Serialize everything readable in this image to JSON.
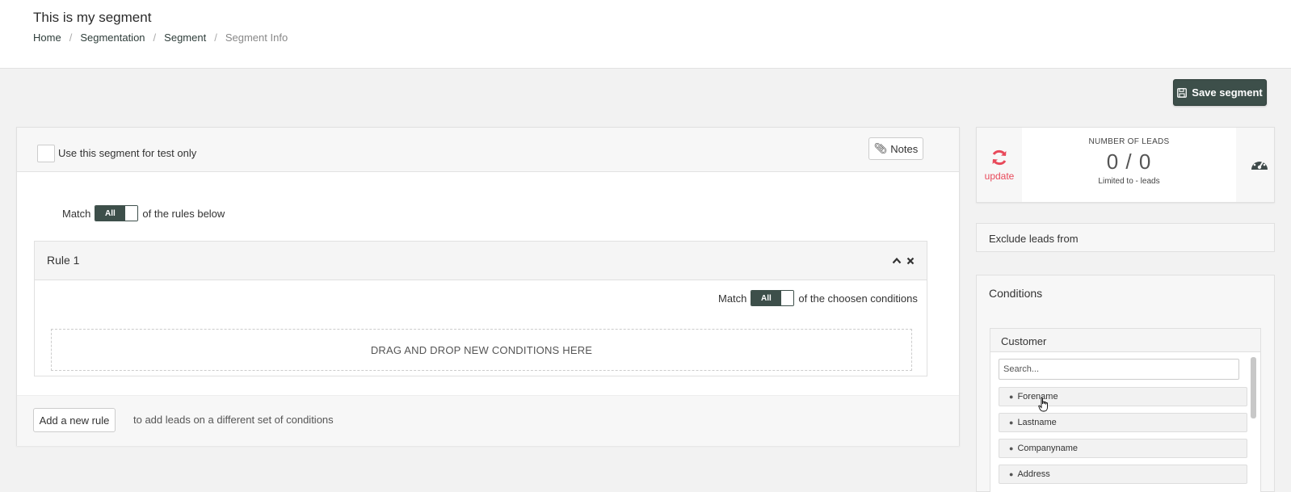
{
  "header": {
    "title": "This is my segment",
    "breadcrumb": [
      {
        "label": "Home"
      },
      {
        "label": "Segmentation"
      },
      {
        "label": "Segment"
      },
      {
        "label": "Segment Info"
      }
    ],
    "separator": "/"
  },
  "toolbar": {
    "save_label": "Save segment"
  },
  "segment": {
    "test_only_label": "Use this segment for test only",
    "test_only_checked": false,
    "notes_label": "Notes",
    "match_prefix": "Match",
    "match_value": "All",
    "match_suffix": "of the rules below"
  },
  "rule": {
    "title": "Rule 1",
    "match_prefix": "Match",
    "match_value": "All",
    "match_suffix": "of the choosen conditions",
    "drop_text": "DRAG AND DROP NEW CONDITIONS HERE"
  },
  "footer": {
    "add_rule_label": "Add a new rule",
    "add_rule_hint": "to add leads on a different set of conditions"
  },
  "leads": {
    "update_label": "update",
    "title": "NUMBER OF LEADS",
    "count": "0 / 0",
    "limit": "Limited to - leads"
  },
  "exclude": {
    "label": "Exclude leads from"
  },
  "conditions": {
    "title": "Conditions",
    "group": {
      "title": "Customer",
      "search_placeholder": "Search...",
      "fields": [
        {
          "label": "Forename"
        },
        {
          "label": "Lastname"
        },
        {
          "label": "Companyname"
        },
        {
          "label": "Address"
        }
      ]
    }
  },
  "colors": {
    "primary": "#3d4f4a",
    "update_accent": "#e8495a"
  },
  "icons": {
    "save": "floppy-disk-icon",
    "notes": "paperclip-icon",
    "collapse": "chevron-up-icon",
    "remove": "close-icon",
    "update": "refresh-icon",
    "gauge": "dashboard-gauge-icon",
    "field": "tag-icon"
  }
}
